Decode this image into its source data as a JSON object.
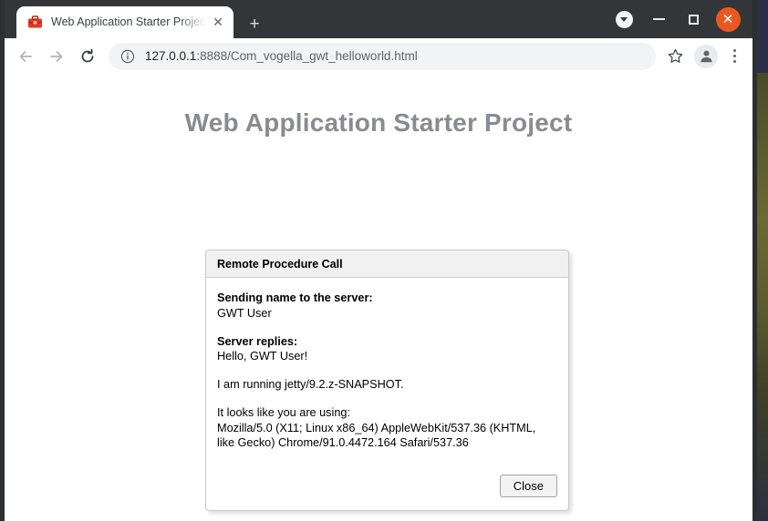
{
  "browser": {
    "tab": {
      "title": "Web Application Starter Project",
      "favicon_icon": "gwt-briefcase-icon",
      "close_icon": "close-icon",
      "close_glyph": "✕"
    },
    "new_tab_label": "+",
    "new_tab_icon": "plus-icon",
    "window_controls": {
      "menu_icon": "chevron-down-icon",
      "minimize_icon": "minimize-icon",
      "maximize_icon": "maximize-icon",
      "close_icon": "close-icon",
      "close_glyph": "✕",
      "close_color": "#e8591f"
    },
    "toolbar": {
      "back_icon": "back-arrow-icon",
      "back_glyph": "←",
      "forward_icon": "forward-arrow-icon",
      "forward_glyph": "→",
      "reload_icon": "reload-icon",
      "bookmark_icon": "star-icon",
      "bookmark_glyph": "☆",
      "profile_icon": "profile-avatar-icon",
      "menu_icon": "three-dot-menu-icon",
      "info_icon": "site-info-icon"
    },
    "address_bar": {
      "host": "127.0.0.1",
      "path": ":8888/Com_vogella_gwt_helloworld.html",
      "full_url": "127.0.0.1:8888/Com_vogella_gwt_helloworld.html"
    }
  },
  "page": {
    "title": "Web Application Starter Project"
  },
  "dialog": {
    "caption": "Remote Procedure Call",
    "sending_label": "Sending name to the server:",
    "sending_value": "GWT User",
    "reply_label": "Server replies:",
    "reply_value": "Hello, GWT User!",
    "server_info": "I am running jetty/9.2.z-SNAPSHOT.",
    "ua_label": "It looks like you are using:",
    "ua_line1": "Mozilla/5.0 (X11; Linux x86_64) AppleWebKit/537.36 (KHTML,",
    "ua_line2": "like Gecko) Chrome/91.0.4472.164 Safari/537.36",
    "close_button": "Close"
  }
}
